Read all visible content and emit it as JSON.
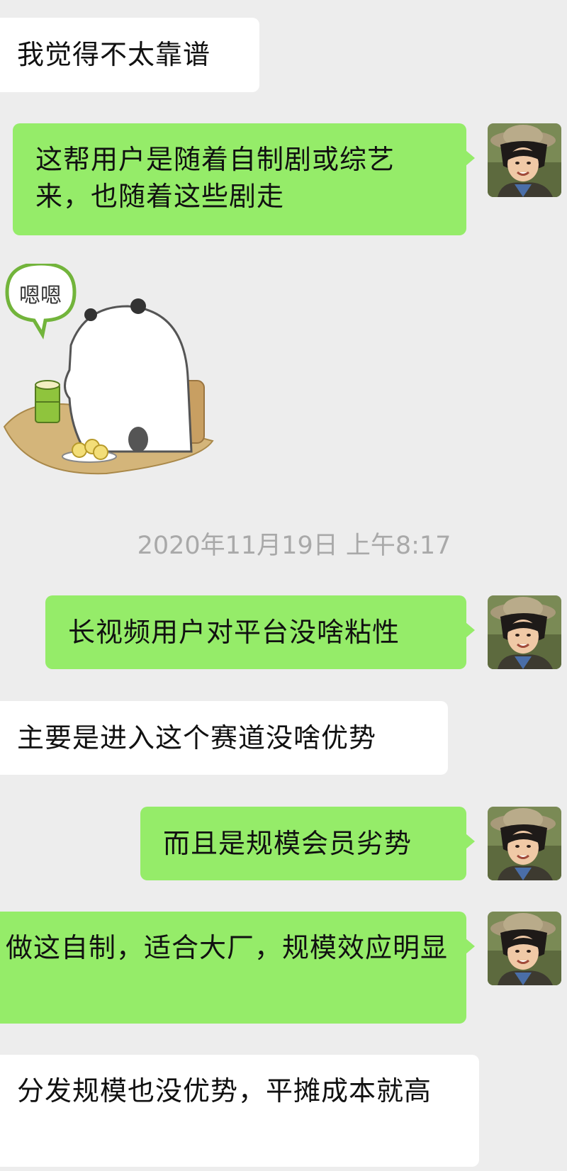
{
  "messages": [
    {
      "side": "in",
      "text": "我觉得不太靠谱"
    },
    {
      "side": "out",
      "text": "这帮用户是随着自制剧或综艺来，也随着这些剧走"
    },
    {
      "type": "sticker",
      "sticker_text": "嗯嗯"
    },
    {
      "side": "out",
      "text": "长视频用户对平台没啥粘性"
    },
    {
      "side": "in",
      "text": "主要是进入这个赛道没啥优势"
    },
    {
      "side": "out",
      "text": "而且是规模会员劣势"
    },
    {
      "side": "out",
      "text": "做这自制，适合大厂，规模效应明显"
    },
    {
      "side": "in",
      "text": "分发规模也没优势，平摊成本就高"
    }
  ],
  "timestamp": "2020年11月19日 上午8:17",
  "colors": {
    "background": "#ededed",
    "outgoing_bubble": "#95ec69",
    "incoming_bubble": "#ffffff",
    "timestamp_text": "#a9a9a9"
  },
  "icons": [
    "avatar-photo",
    "panda-sticker",
    "speech-bubble-icon"
  ]
}
